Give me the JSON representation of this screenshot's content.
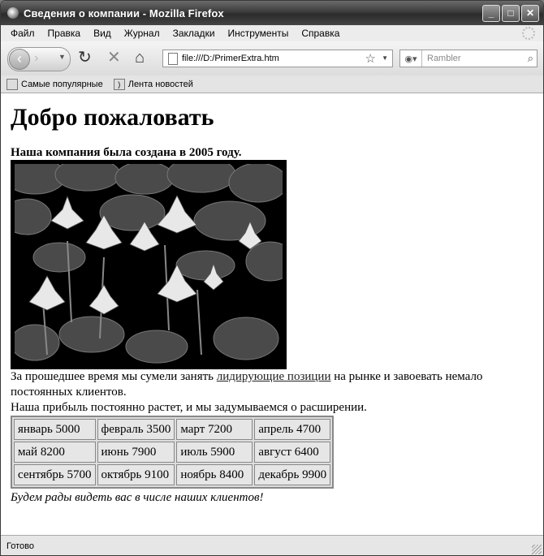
{
  "window": {
    "title": "Сведения о компании - Mozilla Firefox",
    "min_icon": "minimize-icon",
    "max_icon": "maximize-icon",
    "close_icon": "close-icon"
  },
  "menu": [
    "Файл",
    "Правка",
    "Вид",
    "Журнал",
    "Закладки",
    "Инструменты",
    "Справка"
  ],
  "nav": {
    "url": "file:///D:/PrimerExtra.htm",
    "search_placeholder": "Rambler"
  },
  "bookmarks": [
    "Самые популярные",
    "Лента новостей"
  ],
  "page": {
    "heading": "Добро пожаловать",
    "intro": "Наша компания была создана в 2005 году.",
    "para1_before": "За прошедшее время мы сумели занять ",
    "para1_link": "лидирующие позиции",
    "para1_after": " на рынке и завоевать немало постоянных клиентов.",
    "para2": "Наша прибыль постоянно растет, и мы задумываемся о расширении.",
    "sales": [
      [
        "январь 5000",
        "февраль 3500",
        "март 7200",
        "апрель 4700"
      ],
      [
        "май 8200",
        "июнь 7900",
        "июль 5900",
        "август 6400"
      ],
      [
        "сентябрь 5700",
        "октябрь 9100",
        "ноябрь 8400",
        "декабрь 9900"
      ]
    ],
    "closing": "Будем рады видеть вас в числе наших клиентов!"
  },
  "status": "Готово"
}
